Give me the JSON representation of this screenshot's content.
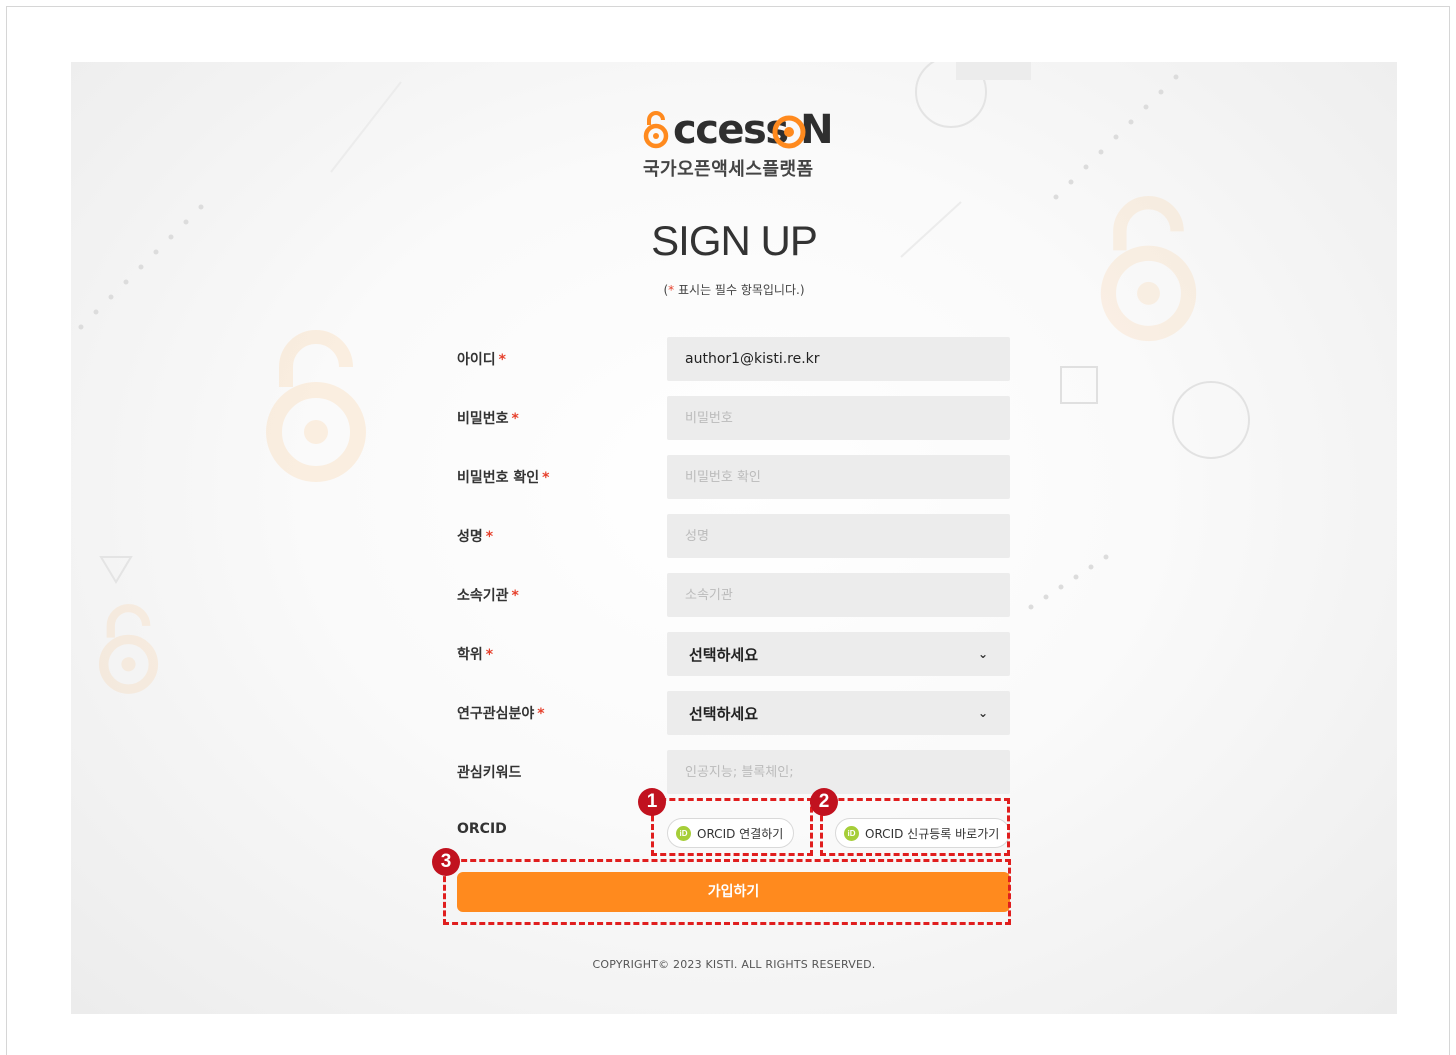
{
  "logo": {
    "brand_text": "ccess N",
    "sub_text": "국가오픈액세스플랫폼"
  },
  "page": {
    "title": "SIGN UP",
    "required_note_prefix": "(",
    "required_note_star": "*",
    "required_note_suffix": "표시는 필수 항목입니다.)"
  },
  "form": {
    "required_mark": "*",
    "id": {
      "label": "아이디",
      "value": "author1@kisti.re.kr"
    },
    "password": {
      "label": "비밀번호",
      "placeholder": "비밀번호"
    },
    "password_confirm": {
      "label": "비밀번호 확인",
      "placeholder": "비밀번호 확인"
    },
    "name": {
      "label": "성명",
      "placeholder": "성명"
    },
    "affiliation": {
      "label": "소속기관",
      "placeholder": "소속기관"
    },
    "degree": {
      "label": "학위",
      "selected": "선택하세요"
    },
    "research_field": {
      "label": "연구관심분야",
      "selected": "선택하세요"
    },
    "keywords": {
      "label": "관심키워드",
      "placeholder": "인공지능; 블록체인;"
    },
    "orcid": {
      "label": "ORCID",
      "logo_text": "iD",
      "connect_label": "ORCID 연결하기",
      "register_label": "ORCID 신규등록 바로가기"
    },
    "submit_label": "가입하기"
  },
  "footer": {
    "copyright": "COPYRIGHT© 2023 KISTI. ALL RIGHTS RESERVED."
  },
  "annotations": {
    "badge_1": "1",
    "badge_2": "2",
    "badge_3": "3"
  },
  "colors": {
    "accent": "#ff8a1e",
    "required": "#e6402c",
    "orcid_green": "#a6ce39",
    "annotation_red": "#e01e1e",
    "badge_red": "#c1121f"
  },
  "icons": {
    "dropdown": "chevron-down-icon",
    "open_access": "open-access-lock-icon",
    "orcid": "orcid-icon"
  }
}
